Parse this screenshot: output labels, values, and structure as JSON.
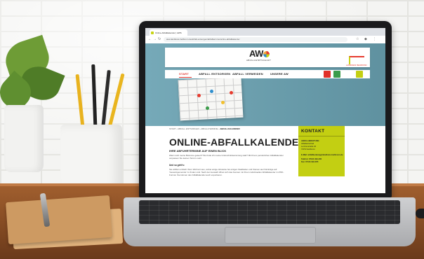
{
  "browser": {
    "tab_title": "Online-Abfallkalender | AWS",
    "url": "aws.landkreis-heilbronn.de/abfall-entsorgen/abfalltermine/online-abfallkalender"
  },
  "site": {
    "logo": "AW",
    "logo_subtitle": "ABFALLWIRTSCHAFT",
    "partner_text": "LANDKREIS HEILBRONN",
    "nav": [
      {
        "label": "START"
      },
      {
        "label": "ABFALL ENTSORGEN"
      },
      {
        "label": "ABFALL VERMEIDEN"
      },
      {
        "label": "UNSERE AW"
      }
    ],
    "breadcrumb": {
      "trail": "START › ABFALL ENTSORGEN › ABFALLTERMINE › ",
      "current": "ABFALLKALENDER"
    },
    "page_title": "ONLINE-ABFALLKALENDER",
    "subtitle": "IHRE ABFUHRTERMINE AUF EINEN BLICK",
    "intro": "Wann wird meine Biotonne geleert? Wo finde ich meine Grünschnittsammlung statt? Mit Ihrem persönlichen Abfallkalender verpassen Sie keinen Termin mehr.",
    "section_head": "Und so geht's:",
    "section_text": "Sie wählen einfach Ihren Wohnort aus, wobei einige Hinweise bei einigen Stadtteilen und Kleinen auch Einträge auf 'Gesamtgemeinde' zu finden sind. Nach der Auswahl öffnet sich das Fenster mit Ihrem individuellen Abfallkalender im PDF-Format. Sie können den Abfallkalender auch exportieren.",
    "kontakt": {
      "title": "KONTAKT",
      "lines": [
        "ABFALLBERATUNG",
        "Abfallwirtschaft",
        "Lerchenstraße 40",
        "74072 Heilbronn"
      ],
      "email": "E-Mail: abfallberatung@landkreis-heilbronn.de",
      "phone": "Telefon: 07131 994-400",
      "fax": "Fax: 07131 994-355"
    }
  },
  "colors": {
    "accent_green": "#c3cf12",
    "accent_red": "#e0312a",
    "hero_blue": "#6aa2b2"
  }
}
